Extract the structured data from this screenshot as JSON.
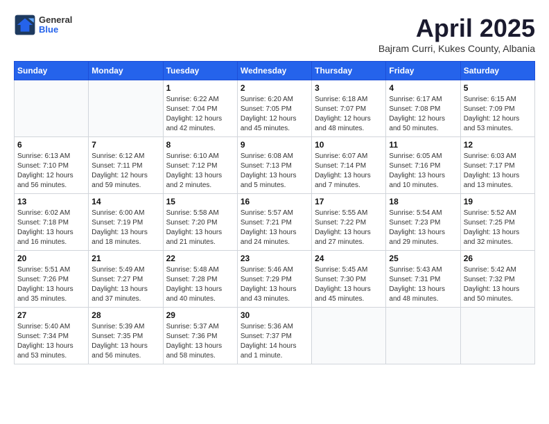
{
  "logo": {
    "general": "General",
    "blue": "Blue"
  },
  "header": {
    "month": "April 2025",
    "location": "Bajram Curri, Kukes County, Albania"
  },
  "weekdays": [
    "Sunday",
    "Monday",
    "Tuesday",
    "Wednesday",
    "Thursday",
    "Friday",
    "Saturday"
  ],
  "weeks": [
    [
      {
        "day": "",
        "detail": ""
      },
      {
        "day": "",
        "detail": ""
      },
      {
        "day": "1",
        "detail": "Sunrise: 6:22 AM\nSunset: 7:04 PM\nDaylight: 12 hours and 42 minutes."
      },
      {
        "day": "2",
        "detail": "Sunrise: 6:20 AM\nSunset: 7:05 PM\nDaylight: 12 hours and 45 minutes."
      },
      {
        "day": "3",
        "detail": "Sunrise: 6:18 AM\nSunset: 7:07 PM\nDaylight: 12 hours and 48 minutes."
      },
      {
        "day": "4",
        "detail": "Sunrise: 6:17 AM\nSunset: 7:08 PM\nDaylight: 12 hours and 50 minutes."
      },
      {
        "day": "5",
        "detail": "Sunrise: 6:15 AM\nSunset: 7:09 PM\nDaylight: 12 hours and 53 minutes."
      }
    ],
    [
      {
        "day": "6",
        "detail": "Sunrise: 6:13 AM\nSunset: 7:10 PM\nDaylight: 12 hours and 56 minutes."
      },
      {
        "day": "7",
        "detail": "Sunrise: 6:12 AM\nSunset: 7:11 PM\nDaylight: 12 hours and 59 minutes."
      },
      {
        "day": "8",
        "detail": "Sunrise: 6:10 AM\nSunset: 7:12 PM\nDaylight: 13 hours and 2 minutes."
      },
      {
        "day": "9",
        "detail": "Sunrise: 6:08 AM\nSunset: 7:13 PM\nDaylight: 13 hours and 5 minutes."
      },
      {
        "day": "10",
        "detail": "Sunrise: 6:07 AM\nSunset: 7:14 PM\nDaylight: 13 hours and 7 minutes."
      },
      {
        "day": "11",
        "detail": "Sunrise: 6:05 AM\nSunset: 7:16 PM\nDaylight: 13 hours and 10 minutes."
      },
      {
        "day": "12",
        "detail": "Sunrise: 6:03 AM\nSunset: 7:17 PM\nDaylight: 13 hours and 13 minutes."
      }
    ],
    [
      {
        "day": "13",
        "detail": "Sunrise: 6:02 AM\nSunset: 7:18 PM\nDaylight: 13 hours and 16 minutes."
      },
      {
        "day": "14",
        "detail": "Sunrise: 6:00 AM\nSunset: 7:19 PM\nDaylight: 13 hours and 18 minutes."
      },
      {
        "day": "15",
        "detail": "Sunrise: 5:58 AM\nSunset: 7:20 PM\nDaylight: 13 hours and 21 minutes."
      },
      {
        "day": "16",
        "detail": "Sunrise: 5:57 AM\nSunset: 7:21 PM\nDaylight: 13 hours and 24 minutes."
      },
      {
        "day": "17",
        "detail": "Sunrise: 5:55 AM\nSunset: 7:22 PM\nDaylight: 13 hours and 27 minutes."
      },
      {
        "day": "18",
        "detail": "Sunrise: 5:54 AM\nSunset: 7:23 PM\nDaylight: 13 hours and 29 minutes."
      },
      {
        "day": "19",
        "detail": "Sunrise: 5:52 AM\nSunset: 7:25 PM\nDaylight: 13 hours and 32 minutes."
      }
    ],
    [
      {
        "day": "20",
        "detail": "Sunrise: 5:51 AM\nSunset: 7:26 PM\nDaylight: 13 hours and 35 minutes."
      },
      {
        "day": "21",
        "detail": "Sunrise: 5:49 AM\nSunset: 7:27 PM\nDaylight: 13 hours and 37 minutes."
      },
      {
        "day": "22",
        "detail": "Sunrise: 5:48 AM\nSunset: 7:28 PM\nDaylight: 13 hours and 40 minutes."
      },
      {
        "day": "23",
        "detail": "Sunrise: 5:46 AM\nSunset: 7:29 PM\nDaylight: 13 hours and 43 minutes."
      },
      {
        "day": "24",
        "detail": "Sunrise: 5:45 AM\nSunset: 7:30 PM\nDaylight: 13 hours and 45 minutes."
      },
      {
        "day": "25",
        "detail": "Sunrise: 5:43 AM\nSunset: 7:31 PM\nDaylight: 13 hours and 48 minutes."
      },
      {
        "day": "26",
        "detail": "Sunrise: 5:42 AM\nSunset: 7:32 PM\nDaylight: 13 hours and 50 minutes."
      }
    ],
    [
      {
        "day": "27",
        "detail": "Sunrise: 5:40 AM\nSunset: 7:34 PM\nDaylight: 13 hours and 53 minutes."
      },
      {
        "day": "28",
        "detail": "Sunrise: 5:39 AM\nSunset: 7:35 PM\nDaylight: 13 hours and 56 minutes."
      },
      {
        "day": "29",
        "detail": "Sunrise: 5:37 AM\nSunset: 7:36 PM\nDaylight: 13 hours and 58 minutes."
      },
      {
        "day": "30",
        "detail": "Sunrise: 5:36 AM\nSunset: 7:37 PM\nDaylight: 14 hours and 1 minute."
      },
      {
        "day": "",
        "detail": ""
      },
      {
        "day": "",
        "detail": ""
      },
      {
        "day": "",
        "detail": ""
      }
    ]
  ]
}
